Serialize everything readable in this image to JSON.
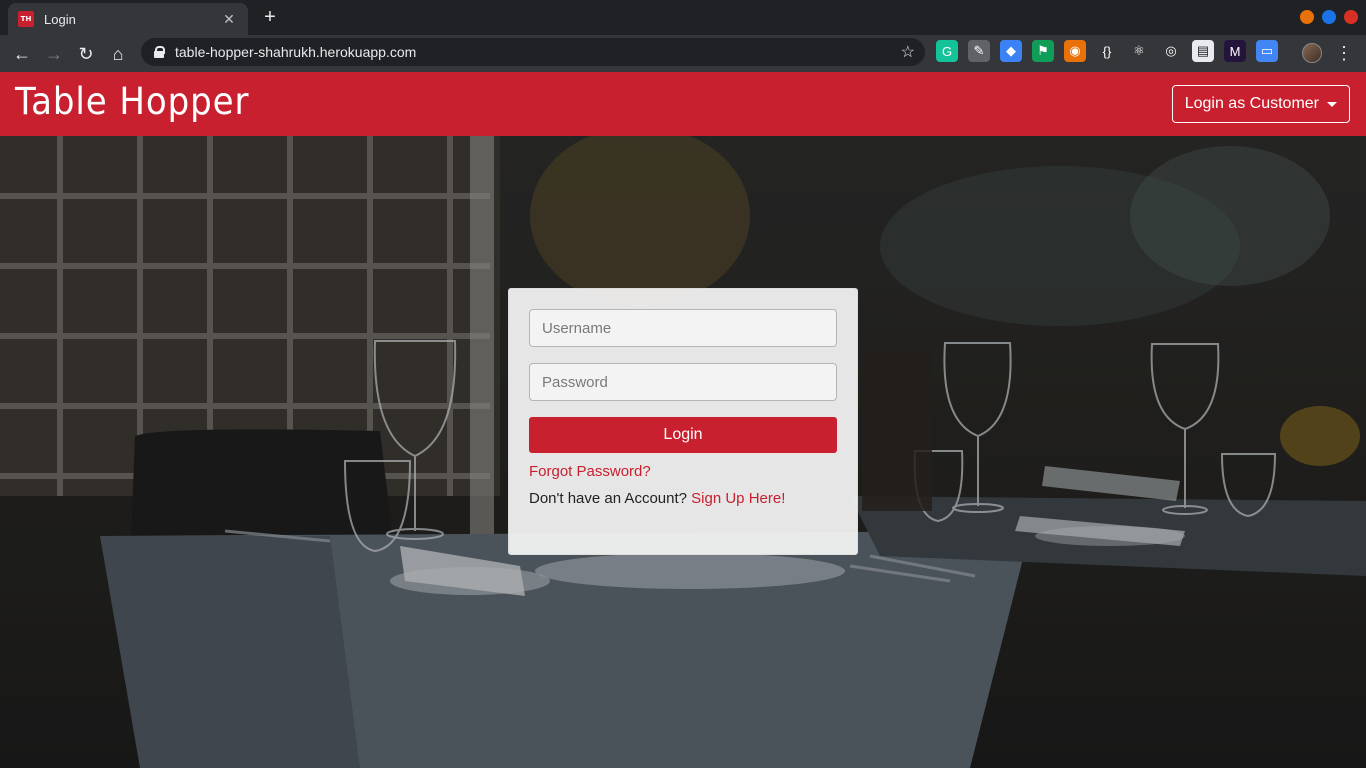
{
  "browser": {
    "tab_title": "Login",
    "favicon_text": "TH",
    "url": "table-hopper-shahrukh.herokuapp.com",
    "window_controls": [
      {
        "name": "minimize",
        "color": "#e8710a"
      },
      {
        "name": "maximize",
        "color": "#1a73e8"
      },
      {
        "name": "close",
        "color": "#d93025"
      }
    ],
    "extensions": [
      {
        "name": "grammarly-icon",
        "glyph": "G",
        "color": "#15c39a"
      },
      {
        "name": "pen-icon",
        "glyph": "✎",
        "color": "#5f6368"
      },
      {
        "name": "ethereum-icon",
        "glyph": "◆",
        "color": "#3b82f6"
      },
      {
        "name": "flag-icon",
        "glyph": "⚑",
        "color": "#0f9d58"
      },
      {
        "name": "owl-icon",
        "glyph": "◉",
        "color": "#e8710a"
      },
      {
        "name": "braces-icon",
        "glyph": "{}",
        "color": "#35363a"
      },
      {
        "name": "react-icon",
        "glyph": "⚛",
        "color": "#35363a"
      },
      {
        "name": "target-icon",
        "glyph": "◎",
        "color": "#35363a"
      },
      {
        "name": "chart-icon",
        "glyph": "▤",
        "color": "#e8eaed"
      },
      {
        "name": "m-icon",
        "glyph": "M",
        "color": "#24133b"
      },
      {
        "name": "window-icon",
        "glyph": "▭",
        "color": "#4285f4"
      }
    ]
  },
  "navbar": {
    "brand": "Table Hopper",
    "login_as": "Login as Customer",
    "color": "#c8202f"
  },
  "login_form": {
    "username_placeholder": "Username",
    "password_placeholder": "Password",
    "submit_label": "Login",
    "forgot_password": "Forgot Password?",
    "no_account_text": "Don't have an Account?",
    "signup_link": "Sign Up Here!"
  }
}
